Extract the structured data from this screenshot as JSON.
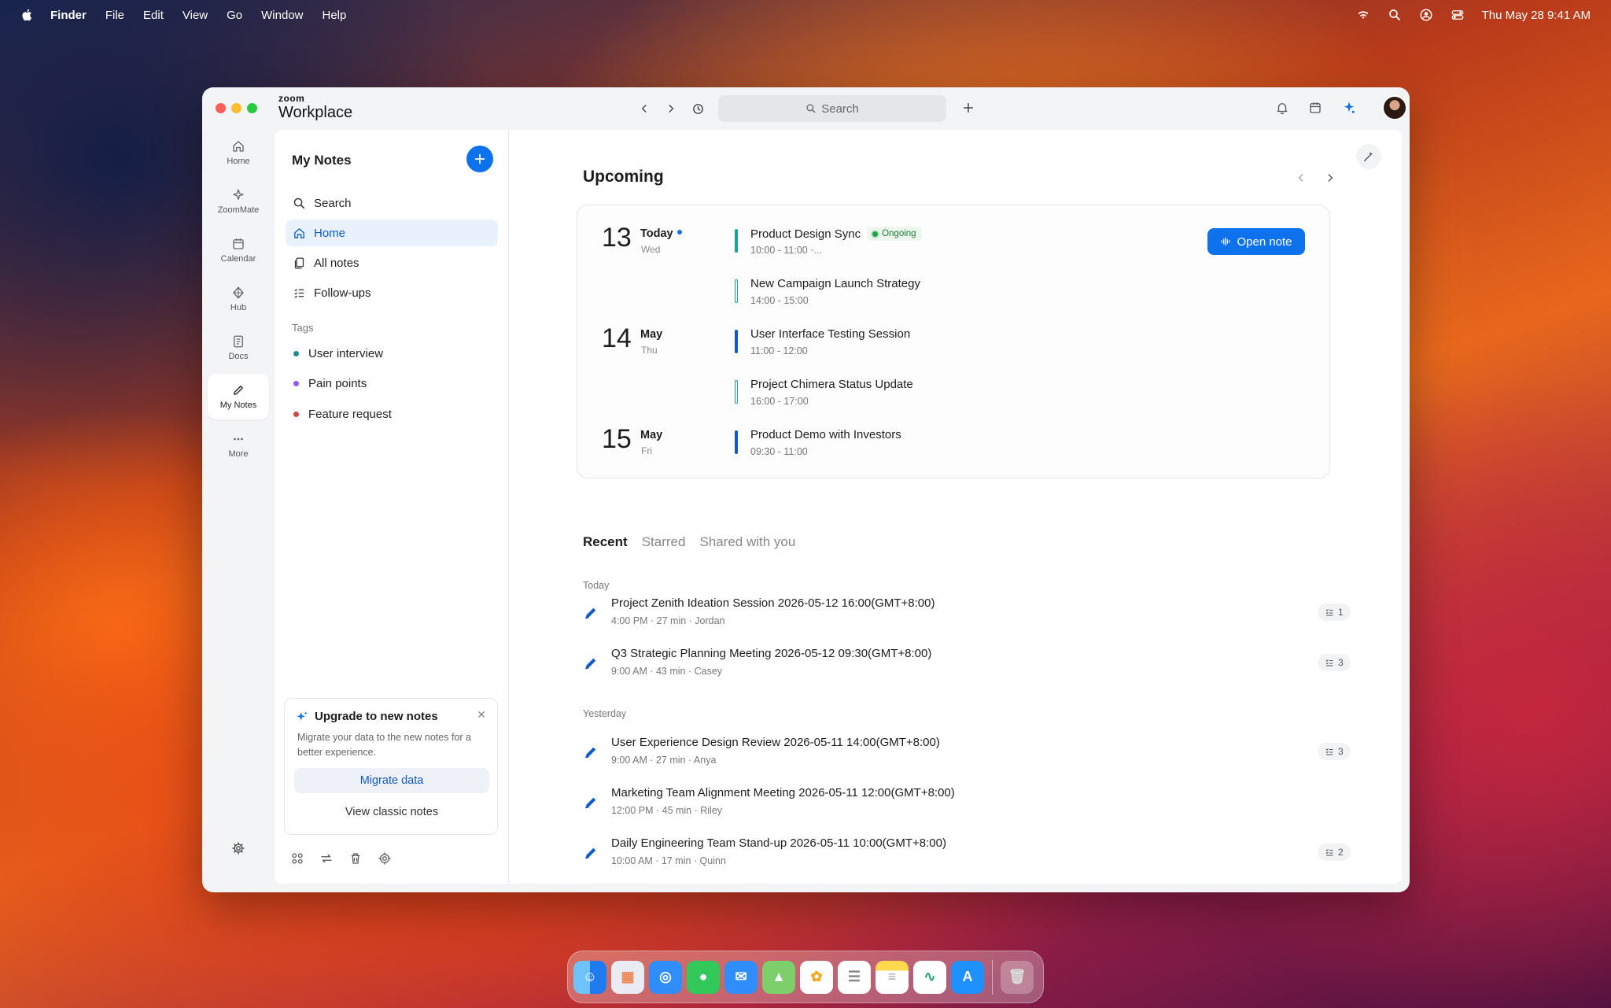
{
  "menubar": {
    "items": [
      "Finder",
      "File",
      "Edit",
      "View",
      "Go",
      "Window",
      "Help"
    ],
    "clock": "Thu May 28  9:41 AM",
    "status_icons": [
      "wifi-icon",
      "spotlight-icon",
      "user-icon",
      "control-center-icon"
    ]
  },
  "app": {
    "brand_small": "zoom",
    "brand_large": "Workplace",
    "search_placeholder": "Search"
  },
  "rail": {
    "items": [
      {
        "label": "Home",
        "icon": "home-icon"
      },
      {
        "label": "ZoomMate",
        "icon": "sparkle-icon"
      },
      {
        "label": "Calendar",
        "icon": "calendar-icon"
      },
      {
        "label": "Hub",
        "icon": "hub-icon"
      },
      {
        "label": "Docs",
        "icon": "docs-icon"
      },
      {
        "label": "My Notes",
        "icon": "pen-icon",
        "active": true
      },
      {
        "label": "More",
        "icon": "more-icon"
      }
    ]
  },
  "notes_sidebar": {
    "title": "My Notes",
    "nav": [
      {
        "label": "Search",
        "icon": "search-icon"
      },
      {
        "label": "Home",
        "icon": "home-icon",
        "active": true
      },
      {
        "label": "All notes",
        "icon": "notes-icon"
      },
      {
        "label": "Follow-ups",
        "icon": "checklist-icon"
      }
    ],
    "tags_heading": "Tags",
    "tags": [
      {
        "label": "User interview",
        "color": "#1f8a8a"
      },
      {
        "label": "Pain points",
        "color": "#8b5cf6"
      },
      {
        "label": "Feature request",
        "color": "#d0453f"
      }
    ],
    "upgrade": {
      "title": "Upgrade to new notes",
      "desc": "Migrate your data to the new notes for a better experience.",
      "primary": "Migrate data",
      "secondary": "View classic notes"
    }
  },
  "upcoming": {
    "title": "Upcoming",
    "days": [
      {
        "num": "13",
        "line1": "Today",
        "line2": "Wed",
        "events": [
          {
            "title": "Product Design Sync",
            "time": "10:00 - 11:00 ·...",
            "badge": "Ongoing",
            "bar": "#1aa39a",
            "solid": true
          },
          {
            "title": "New Campaign Launch Strategy",
            "time": "14:00 - 15:00",
            "bar": "#1aa39a",
            "solid": false
          }
        ]
      },
      {
        "num": "14",
        "line1": "May",
        "line2": "Thu",
        "events": [
          {
            "title": "User Interface Testing Session",
            "time": "11:00 - 12:00",
            "bar": "#0e5bc7",
            "solid": true
          },
          {
            "title": "Project Chimera Status Update",
            "time": "16:00 - 17:00",
            "bar": "#1aa39a",
            "solid": false
          }
        ]
      },
      {
        "num": "15",
        "line1": "May",
        "line2": "Fri",
        "events": [
          {
            "title": "Product Demo with Investors",
            "time": "09:30 - 11:00",
            "bar": "#0e5bc7",
            "solid": true
          }
        ]
      }
    ],
    "open_note": "Open note"
  },
  "recent": {
    "tabs": [
      "Recent",
      "Starred",
      "Shared with you"
    ],
    "groups": [
      {
        "heading": "Today",
        "notes": [
          {
            "title": "Project Zenith Ideation Session 2026-05-12 16:00(GMT+8:00)",
            "meta": "4:00 PM · 27 min · Jordan",
            "followups": "1"
          },
          {
            "title": "Q3 Strategic Planning Meeting 2026-05-12 09:30(GMT+8:00)",
            "meta": "9:00 AM · 43 min · Casey",
            "followups": "3"
          }
        ]
      },
      {
        "heading": "Yesterday",
        "notes": [
          {
            "title": "User Experience Design Review 2026-05-11 14:00(GMT+8:00)",
            "meta": "9:00 AM · 27 min · Anya",
            "followups": "3"
          },
          {
            "title": "Marketing Team Alignment Meeting 2026-05-11 12:00(GMT+8:00)",
            "meta": "12:00 PM · 45 min · Riley",
            "followups": ""
          },
          {
            "title": "Daily Engineering Team Stand-up 2026-05-11 10:00(GMT+8:00)",
            "meta": "10:00 AM · 17 min · Quinn",
            "followups": "2"
          }
        ]
      }
    ]
  },
  "dock": {
    "apps": [
      "Finder",
      "Launchpad",
      "Safari",
      "Messages",
      "Mail",
      "Maps",
      "Photos",
      "Reminders",
      "Notes",
      "Freeform",
      "App Store",
      "Trash"
    ]
  }
}
